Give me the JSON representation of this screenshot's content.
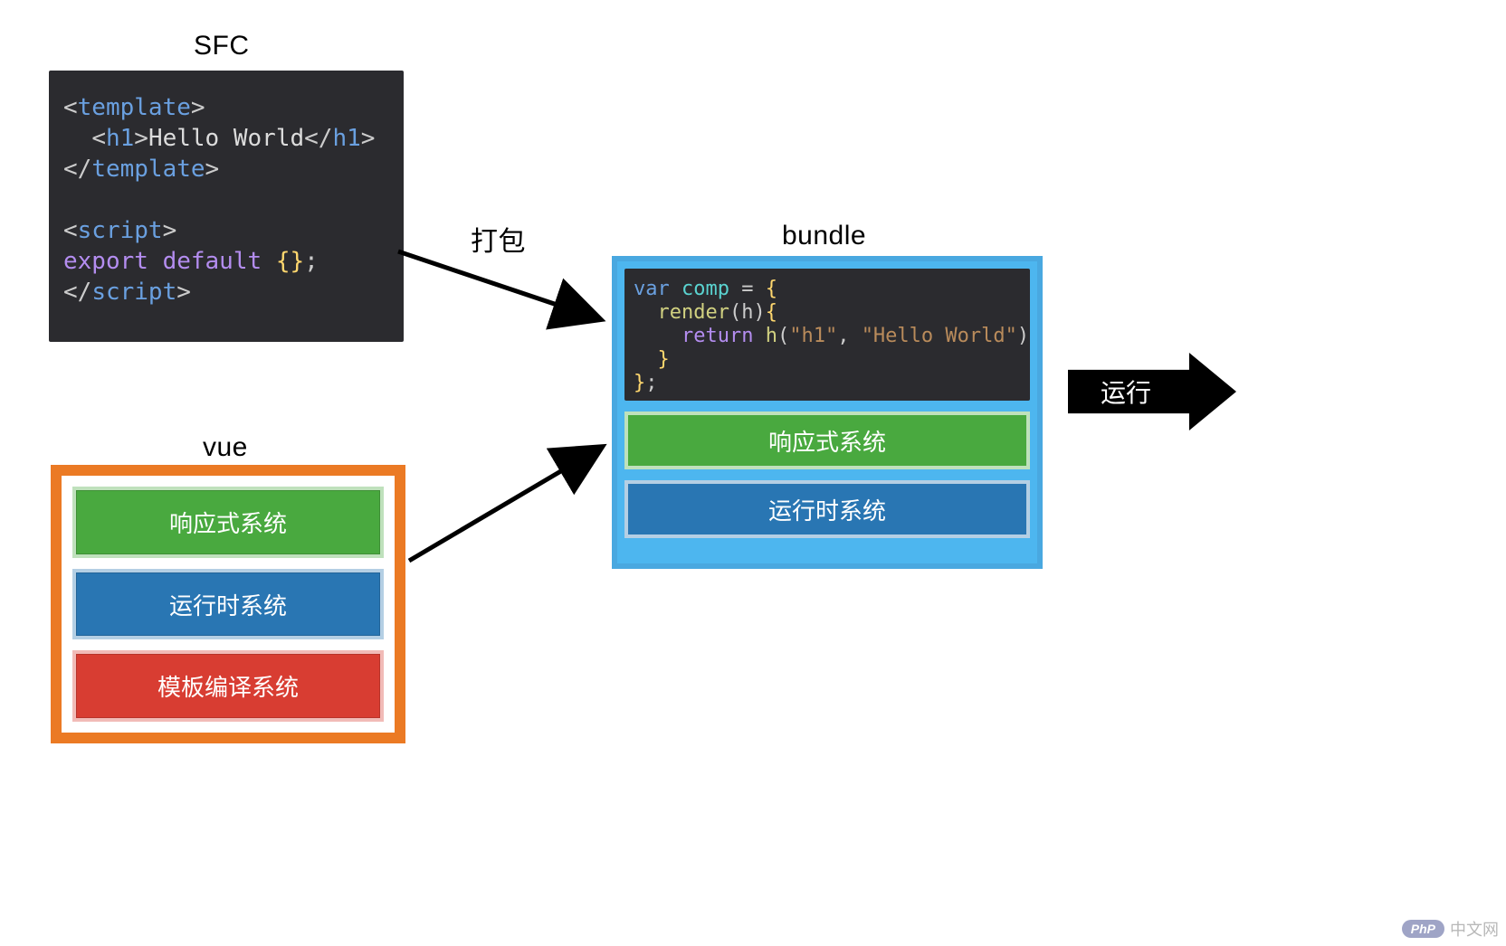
{
  "labels": {
    "sfc": "SFC",
    "vue": "vue",
    "bundle": "bundle",
    "pack": "打包",
    "run": "运行"
  },
  "sfc_code": {
    "template_open_l": "<",
    "template_open_name": "template",
    "template_open_r": ">",
    "h1_open_l": "<",
    "h1_open_name": "h1",
    "h1_open_r": ">",
    "h1_text": "Hello World",
    "h1_close_l": "</",
    "h1_close_name": "h1",
    "h1_close_r": ">",
    "template_close_l": "</",
    "template_close_name": "template",
    "template_close_r": ">",
    "blank": "",
    "script_open_l": "<",
    "script_open_name": "script",
    "script_open_r": ">",
    "export_kw": "export default ",
    "braces": "{}",
    "semi": ";",
    "script_close_l": "</",
    "script_close_name": "script",
    "script_close_r": ">"
  },
  "vue_stack": {
    "reactive": "响应式系统",
    "runtime": "运行时系统",
    "compiler": "模板编译系统"
  },
  "bundle_code": {
    "l1_kw": "var ",
    "l1_name": "comp",
    "l1_assign": " = ",
    "l1_brace": "{",
    "l2_indent": "  ",
    "l2_fn": "render",
    "l2_paren_l": "(",
    "l2_arg": "h",
    "l2_paren_r": ")",
    "l2_brace": "{",
    "l3_indent": "    ",
    "l3_ret": "return ",
    "l3_call": "h",
    "l3_pl": "(",
    "l3_s1": "\"h1\"",
    "l3_comma": ", ",
    "l3_s2": "\"Hello World\"",
    "l3_pr": ")",
    "l4_indent": "  ",
    "l4_brace": "}",
    "l5_brace": "}",
    "l5_semi": ";"
  },
  "bundle_stack": {
    "reactive": "响应式系统",
    "runtime": "运行时系统"
  },
  "watermark": {
    "badge": "PhP",
    "text": "中文网"
  },
  "colors": {
    "orange": "#eb7a24",
    "green": "#49a93f",
    "blue": "#2976b3",
    "red": "#d83d32",
    "lightblue": "#4db6ef",
    "codebg": "#2b2b2f"
  }
}
